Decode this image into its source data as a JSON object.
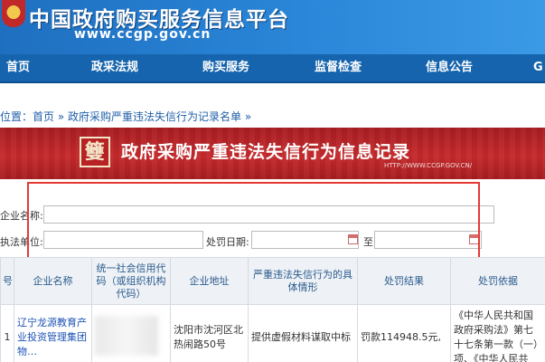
{
  "header": {
    "title": "中国政府购买服务信息平台",
    "url": "www.ccgp.gov.cn"
  },
  "nav": {
    "items": [
      "首页",
      "政采法规",
      "购买服务",
      "监督检查",
      "信息公告",
      "G"
    ]
  },
  "breadcrumb": {
    "prefix": "位置：",
    "home": "首页",
    "sep": " » ",
    "current": "政府采购严重违法失信行为记录名单",
    "tail": " »"
  },
  "banner": {
    "seal": "䉶",
    "title": "政府采购严重违法失信行为信息记录",
    "url": "HTTP://WWW.CCGP.GOV.CN/"
  },
  "search": {
    "company_label": "企业名称:",
    "company_value": "",
    "unit_label": "执法单位:",
    "unit_value": "",
    "date_label": "处罚日期:",
    "date_from": "",
    "to_label": "至",
    "date_to": ""
  },
  "table": {
    "headers": [
      "号",
      "企业名称",
      "统一社会信用代码（或组织机构代码）",
      "企业地址",
      "严重违法失信行为的具体情形",
      "处罚结果",
      "处罚依据"
    ],
    "row": {
      "index": "1",
      "company": "辽宁龙源教育产业投资管理集团物…",
      "address": "沈阳市沈河区北热闹路50号",
      "situation": "提供虚假材料谋取中标",
      "result": "罚款114948.5元,",
      "basis": "《中华人民共和国政府采购法》第七十七条第一款（一）项、《中华人民共"
    }
  }
}
